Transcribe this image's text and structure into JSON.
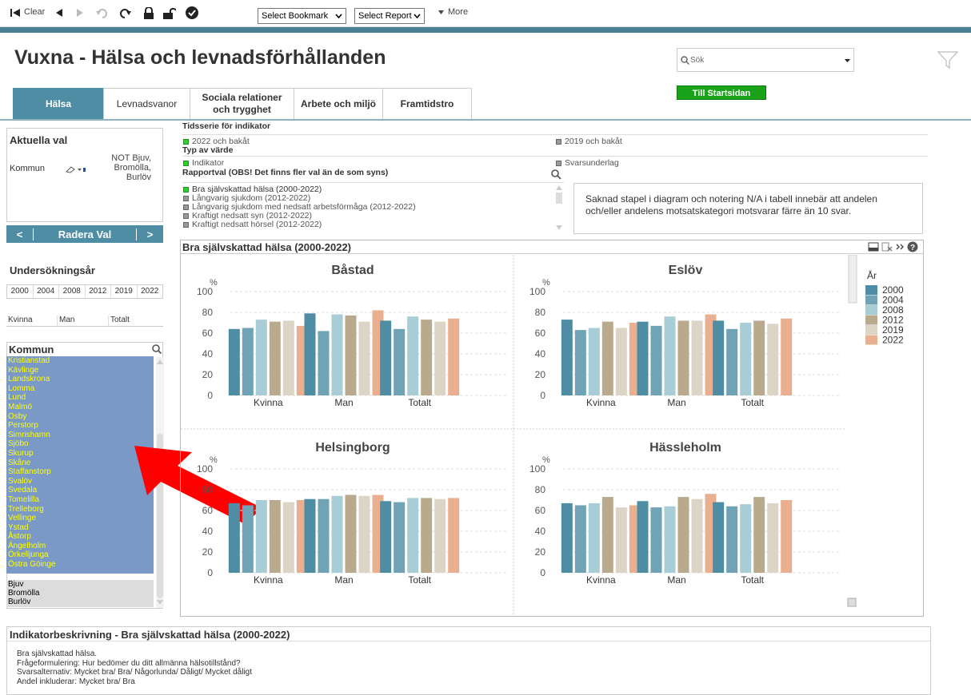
{
  "toolbar": {
    "clear": "Clear",
    "bookmark": "Select Bookmark",
    "report": "Select Report",
    "more": "More"
  },
  "header": {
    "title": "Vuxna - Hälsa och levnadsförhållanden",
    "search_placeholder": "Sök",
    "start_button": "Till Startsidan"
  },
  "tabs": [
    {
      "label": "Hälsa",
      "active": true
    },
    {
      "label": "Levnadsvanor"
    },
    {
      "label": "Sociala relationer och trygghet"
    },
    {
      "label": "Arbete och miljö"
    },
    {
      "label": "Framtidstro"
    }
  ],
  "current": {
    "title": "Aktuella val",
    "field": "Kommun",
    "value": "NOT Bjuv, Bromölla, Burlöv",
    "prev": "<",
    "clear": "Radera Val",
    "next": ">"
  },
  "years": {
    "title": "Undersökningsår",
    "items": [
      "2000",
      "2004",
      "2008",
      "2012",
      "2019",
      "2022"
    ]
  },
  "gender": [
    "Kvinna",
    "Man",
    "Totalt"
  ],
  "kommun": {
    "title": "Kommun",
    "selected": [
      "Kristianstad",
      "Kävlinge",
      "Landskrona",
      "Lomma",
      "Lund",
      "Malmö",
      "Osby",
      "Perstorp",
      "Simrishamn",
      "Sjöbo",
      "Skurup",
      "Skåne",
      "Staffanstorp",
      "Svalöv",
      "Svedala",
      "Tomelilla",
      "Trelleborg",
      "Vellinge",
      "Ystad",
      "Åstorp",
      "Ängelholm",
      "Örkelljunga",
      "Östra Göinge"
    ],
    "excluded": [
      "Bjuv",
      "Bromölla",
      "Burlöv"
    ]
  },
  "options": {
    "series_title": "Tidsserie för indikator",
    "series": [
      "2022 och bakåt",
      "2019 och bakåt"
    ],
    "type_title": "Typ av värde",
    "types": [
      "Indikator",
      "Svarsunderlag"
    ],
    "report_title": "Rapportval (OBS! Det finns fler val än de som syns)",
    "reports": [
      "Bra självskattad hälsa (2000-2022)",
      "Långvarig sjukdom (2012-2022)",
      "Långvarig sjukdom med nedsatt arbetsförmåga (2012-2022)",
      "Kraftigt nedsatt syn (2012-2022)",
      "Kraftigt nedsatt hörsel (2012-2022)"
    ]
  },
  "note": "Saknad stapel i diagram och notering N/A i tabell innebär att andelen och/eller andelens motsatskategori motsvarar färre än 10 svar.",
  "chart_title": "Bra självskattad hälsa (2000-2022)",
  "legend": {
    "title": "År",
    "colors": {
      "2000": "#4f8da4",
      "2004": "#6fa3b5",
      "2008": "#a8cdd6",
      "2012": "#b9aa8e",
      "2019": "#ddd4c8",
      "2022": "#e8b08e"
    }
  },
  "chart_data": [
    {
      "type": "bar",
      "title": "Båstad",
      "ylabel": "%",
      "ylim": [
        0,
        100
      ],
      "yticks": [
        0,
        20,
        40,
        60,
        80,
        100
      ],
      "categories": [
        "Kvinna",
        "Man",
        "Totalt"
      ],
      "series": [
        {
          "name": "2000",
          "values": [
            64,
            79,
            72
          ]
        },
        {
          "name": "2004",
          "values": [
            65,
            62,
            64
          ]
        },
        {
          "name": "2008",
          "values": [
            73,
            78,
            76
          ]
        },
        {
          "name": "2012",
          "values": [
            71,
            77,
            73
          ]
        },
        {
          "name": "2019",
          "values": [
            72,
            71,
            71
          ]
        },
        {
          "name": "2022",
          "values": [
            67,
            82,
            74
          ]
        }
      ]
    },
    {
      "type": "bar",
      "title": "Eslöv",
      "ylabel": "%",
      "ylim": [
        0,
        100
      ],
      "yticks": [
        0,
        20,
        40,
        60,
        80,
        100
      ],
      "categories": [
        "Kvinna",
        "Man",
        "Totalt"
      ],
      "series": [
        {
          "name": "2000",
          "values": [
            73,
            71,
            72
          ]
        },
        {
          "name": "2004",
          "values": [
            63,
            67,
            64
          ]
        },
        {
          "name": "2008",
          "values": [
            65,
            76,
            70
          ]
        },
        {
          "name": "2012",
          "values": [
            71,
            72,
            72
          ]
        },
        {
          "name": "2019",
          "values": [
            65,
            72,
            69
          ]
        },
        {
          "name": "2022",
          "values": [
            70,
            78,
            74
          ]
        }
      ]
    },
    {
      "type": "bar",
      "title": "Helsingborg",
      "ylabel": "%",
      "ylim": [
        0,
        100
      ],
      "yticks": [
        0,
        20,
        40,
        60,
        80,
        100
      ],
      "categories": [
        "Kvinna",
        "Man",
        "Totalt"
      ],
      "series": [
        {
          "name": "2000",
          "values": [
            67,
            71,
            69
          ]
        },
        {
          "name": "2004",
          "values": [
            65,
            71,
            68
          ]
        },
        {
          "name": "2008",
          "values": [
            70,
            74,
            72
          ]
        },
        {
          "name": "2012",
          "values": [
            70,
            75,
            72
          ]
        },
        {
          "name": "2019",
          "values": [
            68,
            74,
            71
          ]
        },
        {
          "name": "2022",
          "values": [
            70,
            75,
            72
          ]
        }
      ]
    },
    {
      "type": "bar",
      "title": "Hässleholm",
      "ylabel": "%",
      "ylim": [
        0,
        100
      ],
      "yticks": [
        0,
        20,
        40,
        60,
        80,
        100
      ],
      "categories": [
        "Kvinna",
        "Man",
        "Totalt"
      ],
      "series": [
        {
          "name": "2000",
          "values": [
            67,
            69,
            68
          ]
        },
        {
          "name": "2004",
          "values": [
            65,
            63,
            64
          ]
        },
        {
          "name": "2008",
          "values": [
            67,
            64,
            66
          ]
        },
        {
          "name": "2012",
          "values": [
            73,
            73,
            73
          ]
        },
        {
          "name": "2019",
          "values": [
            63,
            71,
            67
          ]
        },
        {
          "name": "2022",
          "values": [
            65,
            76,
            70
          ]
        }
      ]
    }
  ],
  "description": {
    "title": "Indikatorbeskrivning - Bra självskattad hälsa (2000-2022)",
    "lines": [
      "Bra självskattad hälsa.",
      "Frågeformulering: Hur bedömer du ditt allmänna hälsotillstånd?",
      "Svarsalternativ: Mycket bra/ Bra/ Någorlunda/ Dåligt/ Mycket dåligt",
      "Andel inkluderar: Mycket bra/ Bra"
    ]
  }
}
